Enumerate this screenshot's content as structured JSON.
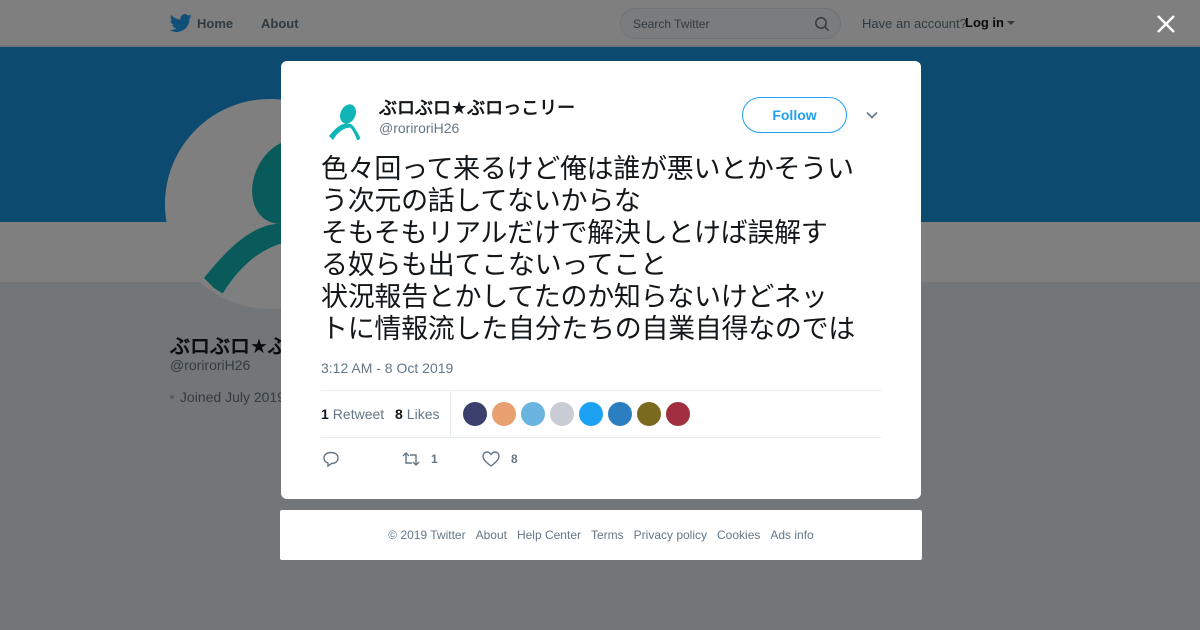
{
  "nav": {
    "home_label": "Home",
    "about_label": "About",
    "search_placeholder": "Search Twitter",
    "have_account": "Have an account?",
    "login_label": "Log in"
  },
  "profile": {
    "name": "ぶロぶロ★ぶロっこリー",
    "handle": "@roriroriH26",
    "joined": "Joined July 2019",
    "banner_color": "#1b95e0"
  },
  "tweet": {
    "display_name": "ぶロぶロ★ぶロっこリー",
    "screen_name": "@roriroriH26",
    "follow_label": "Follow",
    "text_lines": [
      "色々回って来るけど俺は誰が悪いとかそうい",
      "う次元の話してないからな",
      "そもそもリアルだけで解決しとけば誤解す",
      "る奴らも出てこないってこと",
      "状況報告とかしてたのか知らないけどネッ",
      "トに情報流した自分たちの自業自得なのでは"
    ],
    "timestamp": "3:12 AM - 8 Oct 2019",
    "retweet_count": "1",
    "retweet_label": "Retweet",
    "like_count": "8",
    "like_label": "Likes",
    "reply_action_count": "",
    "retweet_action_count": "1",
    "like_action_count": "8"
  },
  "likers": [
    "#3a3f6b",
    "#e8a070",
    "#6ab4e0",
    "#c8ccd4",
    "#1da1f2",
    "#2b7fc0",
    "#7a6a20",
    "#a03040"
  ],
  "colors": {
    "accent": "#1da1f2",
    "avatar_teal": "#12b5b5"
  },
  "footer": {
    "copyright": "© 2019 Twitter",
    "links": [
      "About",
      "Help Center",
      "Terms",
      "Privacy policy",
      "Cookies",
      "Ads info"
    ]
  }
}
